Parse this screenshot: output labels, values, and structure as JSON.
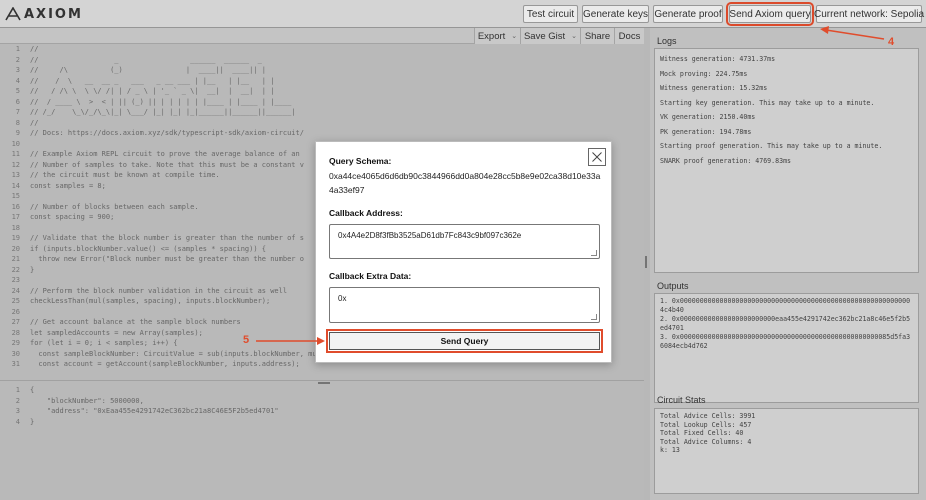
{
  "app": {
    "logo_text": "AXIOM"
  },
  "toolbar": {
    "test_circuit": "Test circuit",
    "generate_keys": "Generate keys",
    "generate_proof": "Generate proof",
    "send_axiom_query": "Send Axiom query",
    "current_network": "Current network: Sepolia"
  },
  "editor_toolbar": {
    "export": "Export",
    "save_gist": "Save Gist",
    "share": "Share",
    "docs": "Docs"
  },
  "code_lines": [
    {
      "n": "1",
      "t": "//"
    },
    {
      "n": "2",
      "t": "//                  _                 ______  ______  _"
    },
    {
      "n": "3",
      "t": "//     /\\          (_)               |  ____||  ____|| |"
    },
    {
      "n": "4",
      "t": "//    /  \\   __  __ _   ___   _ __ ___ | |__   | |__   | |"
    },
    {
      "n": "5",
      "t": "//   / /\\ \\  \\ \\/ /| | / _ \\ | '_ ` _ \\|  __|  |  __|  | |"
    },
    {
      "n": "6",
      "t": "//  / ____ \\  >  < | || (_) || | | | | | |____ | |____ | |____"
    },
    {
      "n": "7",
      "t": "// /_/    \\_\\/_/\\_\\|_| \\___/ |_| |_| |_|______||______||______|"
    },
    {
      "n": "8",
      "t": "//"
    },
    {
      "n": "9",
      "t": "// Docs: https://docs.axiom.xyz/sdk/typescript-sdk/axiom-circuit/"
    },
    {
      "n": "10",
      "t": ""
    },
    {
      "n": "11",
      "t": "// Example Axiom REPL circuit to prove the average balance of an"
    },
    {
      "n": "12",
      "t": "// Number of samples to take. Note that this must be a constant v"
    },
    {
      "n": "13",
      "t": "// the circuit must be known at compile time."
    },
    {
      "n": "14",
      "t": "const samples = 8;"
    },
    {
      "n": "15",
      "t": ""
    },
    {
      "n": "16",
      "t": "// Number of blocks between each sample."
    },
    {
      "n": "17",
      "t": "const spacing = 900;"
    },
    {
      "n": "18",
      "t": ""
    },
    {
      "n": "19",
      "t": "// Validate that the block number is greater than the number of s"
    },
    {
      "n": "20",
      "t": "if (inputs.blockNumber.value() <= (samples * spacing)) {"
    },
    {
      "n": "21",
      "t": "  throw new Error(\"Block number must be greater than the number o"
    },
    {
      "n": "22",
      "t": "}"
    },
    {
      "n": "23",
      "t": ""
    },
    {
      "n": "24",
      "t": "// Perform the block number validation in the circuit as well"
    },
    {
      "n": "25",
      "t": "checkLessThan(mul(samples, spacing), inputs.blockNumber);"
    },
    {
      "n": "26",
      "t": ""
    },
    {
      "n": "27",
      "t": "// Get account balance at the sample block numbers"
    },
    {
      "n": "28",
      "t": "let sampledAccounts = new Array(samples);"
    },
    {
      "n": "29",
      "t": "for (let i = 0; i < samples; i++) {"
    },
    {
      "n": "30",
      "t": "  const sampleBlockNumber: CircuitValue = sub(inputs.blockNumber, mul(spacing, i));"
    },
    {
      "n": "31",
      "t": "  const account = getAccount(sampleBlockNumber, inputs.address);"
    }
  ],
  "input_lines": [
    {
      "n": "1",
      "t": "{"
    },
    {
      "n": "2",
      "t": "    \"blockNumber\": 5000000,"
    },
    {
      "n": "3",
      "t": "    \"address\": \"0xEaa455e4291742eC362bc21a8C46E5F2b5ed4701\""
    },
    {
      "n": "4",
      "t": "}"
    }
  ],
  "logs": {
    "title": "Logs",
    "lines": [
      "Witness generation: 4731.37ms",
      "Mock proving: 224.75ms",
      "Witness generation: 15.32ms",
      "Starting key generation. This may take up to a minute.",
      "VK generation: 2150.40ms",
      "PK generation: 194.78ms",
      "Starting proof generation. This may take up to a minute.",
      "SNARK proof generation: 4769.83ms"
    ]
  },
  "outputs": {
    "title": "Outputs",
    "lines": [
      "1. 0x00000000000000000000000000000000000000000000000000000000004c4b40",
      "2. 0x000000000000000000000000eaa455e4291742ec362bc21a8c46e5f2b5ed4701",
      "3. 0x00000000000000000000000000000000000000000000000000085d5fa36084ecb4d762"
    ]
  },
  "stats": {
    "title": "Circuit Stats",
    "lines": [
      "Total Advice Cells: 3991",
      "Total Lookup Cells: 457",
      "Total Fixed Cells: 40",
      "Total Advice Columns: 4",
      "k: 13"
    ]
  },
  "modal": {
    "query_schema_label": "Query Schema:",
    "query_schema_value": "0xa44ce4065d6d6db90c3844966dd0a804e28cc5b8e9e02ca38d10e33a4a33ef97",
    "callback_address_label": "Callback Address:",
    "callback_address_value": "0x4A4e2D8f3fBb3525aD61db7Fc843c9bf097c362e",
    "callback_extra_label": "Callback Extra Data:",
    "callback_extra_value": "0x",
    "send_query_label": "Send Query"
  },
  "annotations": {
    "step4": "4",
    "step5": "5"
  },
  "colors": {
    "annotation": "#e04c2c"
  }
}
